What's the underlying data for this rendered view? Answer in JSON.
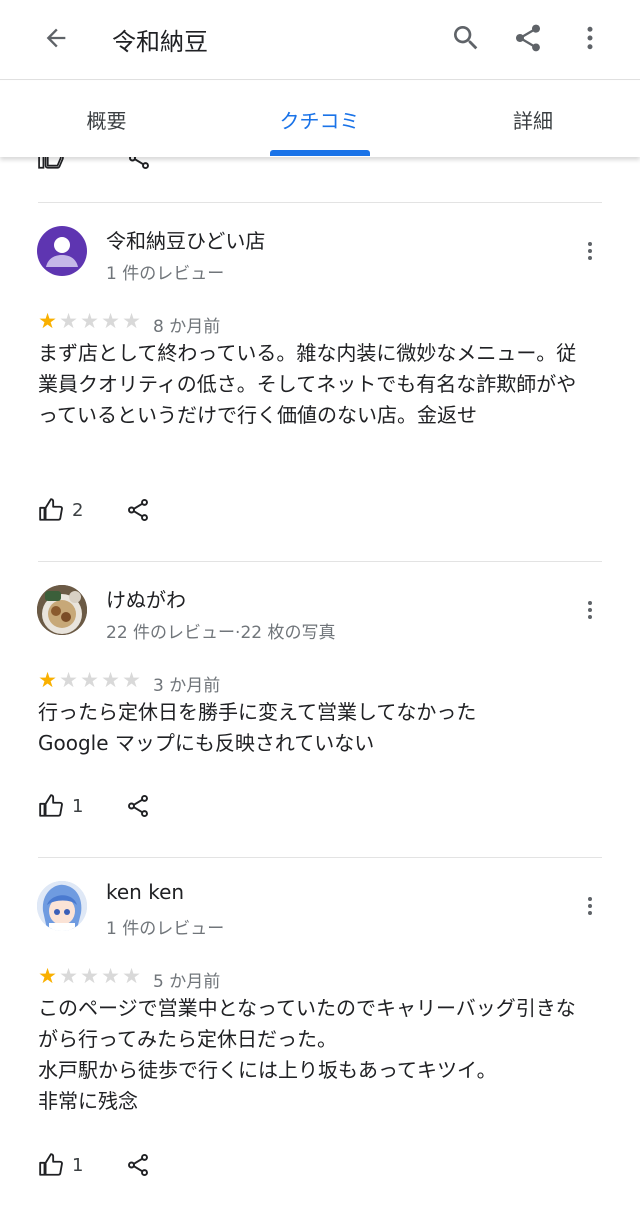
{
  "appbar": {
    "title": "令和納豆",
    "back_icon": "arrow-back-icon",
    "actions": [
      "search-icon",
      "share-icon",
      "more-vert-icon"
    ]
  },
  "tabs": [
    {
      "label": "概要",
      "active": false
    },
    {
      "label": "クチコミ",
      "active": true
    },
    {
      "label": "詳細",
      "active": false
    }
  ],
  "reviews": [
    {
      "name": "令和納豆ひどい店",
      "meta": "1 件のレビュー",
      "rating": 1,
      "max_rating": 5,
      "time": "8 か月前",
      "text": "まず店として終わっている。雑な内装に微妙なメニュー。従業員クオリティの低さ。そしてネットでも有名な詐欺師がやっているというだけで行く価値のない店。金返せ",
      "likes": "2"
    },
    {
      "name": "けぬがわ",
      "meta": "22 件のレビュー·22 枚の写真",
      "rating": 1,
      "max_rating": 5,
      "time": "3 か月前",
      "text": "行ったら定休日を勝手に変えて営業してなかった\nGoogle マップにも反映されていない",
      "likes": "1"
    },
    {
      "name": "ken ken",
      "meta": "1 件のレビュー",
      "rating": 1,
      "max_rating": 5,
      "time": "5 か月前",
      "text": "このページで営業中となっていたのでキャリーバッグ引きながら行ってみたら定休日だった。\n水戸駅から徒歩で行くには上り坂もあってキツイ。\n非常に残念",
      "likes": "1"
    }
  ],
  "colors": {
    "accent": "#1a73e8",
    "star_on": "#f9b000",
    "star_off": "#d9d9d9",
    "avatar_default": "#5e35b1"
  }
}
